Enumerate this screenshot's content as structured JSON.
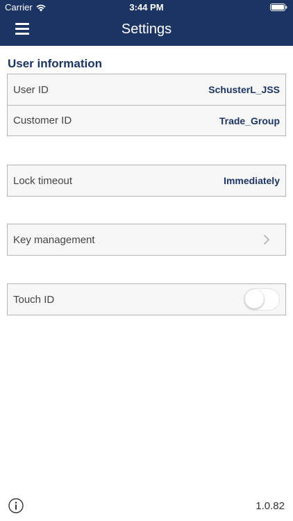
{
  "status_bar": {
    "carrier": "Carrier",
    "time": "3:44 PM",
    "wifi_icon": "wifi-icon",
    "battery_icon": "battery-icon"
  },
  "header": {
    "title": "Settings",
    "menu_icon": "hamburger-menu-icon",
    "background_color": "#1c3461"
  },
  "user_information": {
    "section_title": "User information",
    "rows": [
      {
        "label": "User ID",
        "value": "SchusterL_JSS"
      },
      {
        "label": "Customer ID",
        "value": "Trade_Group"
      }
    ]
  },
  "lock_timeout": {
    "label": "Lock timeout",
    "value": "Immediately"
  },
  "key_management": {
    "label": "Key management",
    "icon": "chevron-right-icon"
  },
  "touch_id": {
    "label": "Touch ID",
    "enabled": false
  },
  "footer": {
    "info_icon": "info-icon",
    "version": "1.0.82"
  },
  "colors": {
    "accent": "#1c3461",
    "row_background": "#f7f7f7",
    "border": "#b5b5b5"
  }
}
